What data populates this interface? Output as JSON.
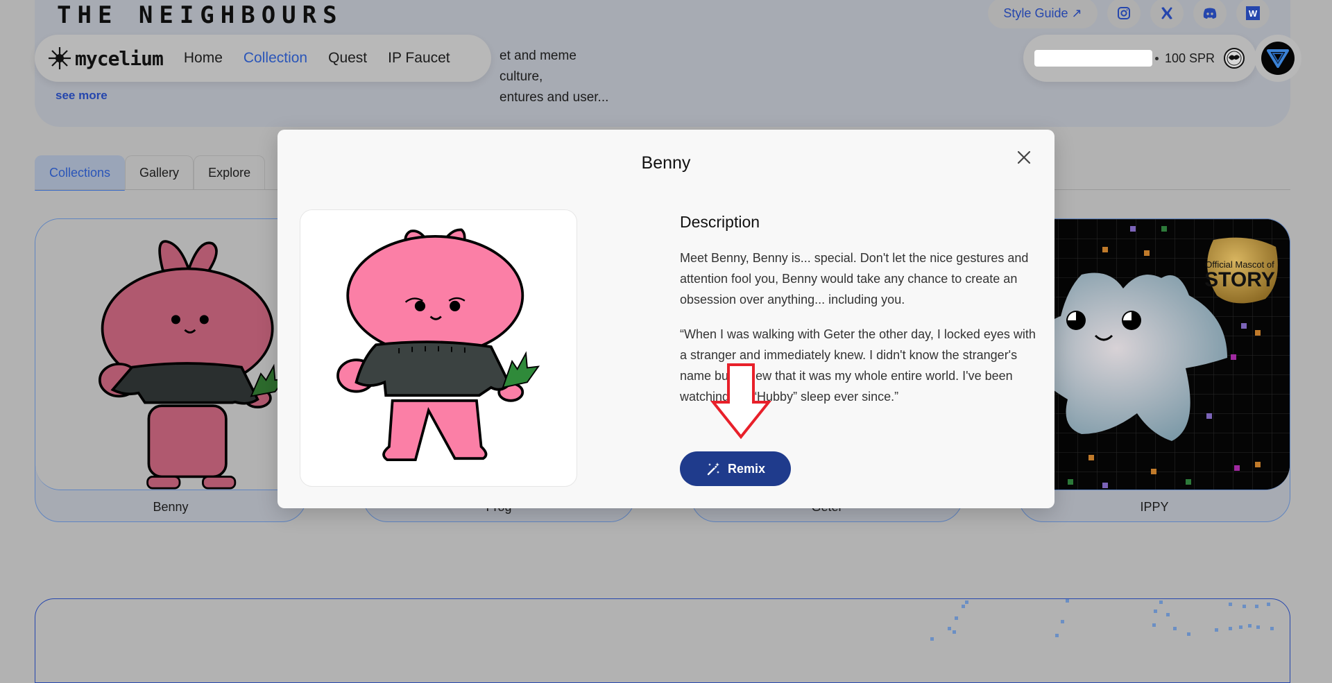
{
  "page": {
    "hero": {
      "title": "THE NEIGHBOURS",
      "description_line1": "et and meme culture,",
      "description_line2": "entures and user...",
      "see_more": "see more"
    },
    "nav": {
      "brand": "mycelium",
      "items": [
        {
          "label": "Home",
          "active": false
        },
        {
          "label": "Collection",
          "active": true
        },
        {
          "label": "Quest",
          "active": false
        },
        {
          "label": "IP Faucet",
          "active": false
        }
      ]
    },
    "top_links": {
      "style_guide": "Style Guide ↗",
      "socials": [
        "instagram-icon",
        "x-icon",
        "discord-icon",
        "w-icon"
      ]
    },
    "wallet": {
      "balance": "100 SPR"
    },
    "tabs": [
      {
        "label": "Collections",
        "active": true
      },
      {
        "label": "Gallery",
        "active": false
      },
      {
        "label": "Explore",
        "active": false
      }
    ],
    "cards": [
      {
        "name": "Benny"
      },
      {
        "name": "Frog"
      },
      {
        "name": "Geter"
      },
      {
        "name": "IPPY",
        "badge_line1": "Official Mascot of",
        "badge_line2": "STORY"
      }
    ]
  },
  "modal": {
    "title": "Benny",
    "description_heading": "Description",
    "paragraphs": [
      "Meet Benny, Benny is... special. Don't let the nice gestures and attention fool you, Benny would take any chance to create an obsession over anything... including you.",
      "“When I was walking with Geter the other day, I locked eyes with a stranger and immediately knew. I didn't know the stranger's name but I knew that it was my whole entire world. I've been watching my “Hubby” sleep ever since.”"
    ],
    "remix_label": "Remix"
  },
  "colors": {
    "accent": "#2a55b8",
    "remix_button": "#1f3b8c",
    "annotation_arrow": "#e8202a"
  }
}
